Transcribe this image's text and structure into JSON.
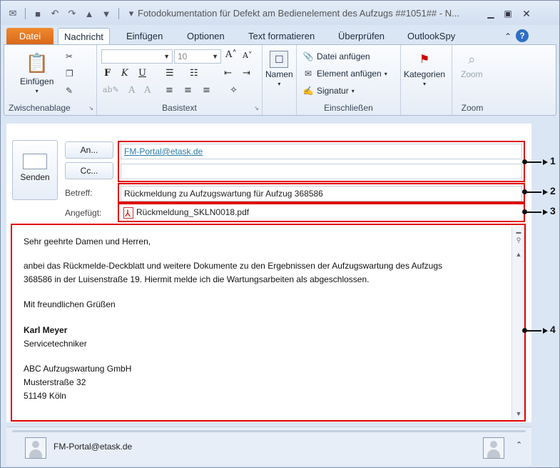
{
  "window": {
    "title": "Fotodokumentation für Defekt am Bedienelement des Aufzugs ##1051## - N..."
  },
  "tabs": [
    "Datei",
    "Nachricht",
    "Einfügen",
    "Optionen",
    "Text formatieren",
    "Überprüfen",
    "OutlookSpy"
  ],
  "ribbon": {
    "clipboard": {
      "paste": "Einfügen",
      "label": "Zwischenablage"
    },
    "basic_text": {
      "font_size": "10",
      "label": "Basistext"
    },
    "names": {
      "label": "Namen"
    },
    "include": {
      "attach_file": "Datei anfügen",
      "attach_item": "Element anfügen",
      "signature": "Signatur",
      "label": "Einschließen"
    },
    "tags": {
      "categories": "Kategorien"
    },
    "zoom": {
      "button": "Zoom",
      "label": "Zoom"
    }
  },
  "compose": {
    "send": "Senden",
    "to_button": "An...",
    "cc_button": "Cc...",
    "to_value": "FM-Portal@etask.de",
    "cc_value": "",
    "subject_label": "Betreff:",
    "subject_value": "Rückmeldung zu Aufzugswartung für Aufzug 368586",
    "attached_label": "Angefügt:",
    "attachment": "Rückmeldung_SKLN0018.pdf"
  },
  "body": {
    "greeting": "Sehr geehrte Damen und Herren,",
    "line1": "anbei das Rückmelde-Deckblatt und weitere Dokumente zu den Ergebnissen der Aufzugswartung des Aufzugs",
    "line2": "368586 in der Luisenstraße 19. Hiermit melde ich die Wartungsarbeiten als abgeschlossen.",
    "closing": "Mit freundlichen Grüßen",
    "name": "Karl Meyer",
    "role": "Servicetechniker",
    "company": "ABC Aufzugswartung GmbH",
    "street": "Musterstraße 32",
    "city": "51149 Köln"
  },
  "people_pane": {
    "contact": "FM-Portal@etask.de"
  },
  "callouts": [
    "1",
    "2",
    "3",
    "4"
  ],
  "colors": {
    "annotation": "#e00000",
    "file_tab": "#e3751f",
    "link": "#2b7aa8"
  }
}
